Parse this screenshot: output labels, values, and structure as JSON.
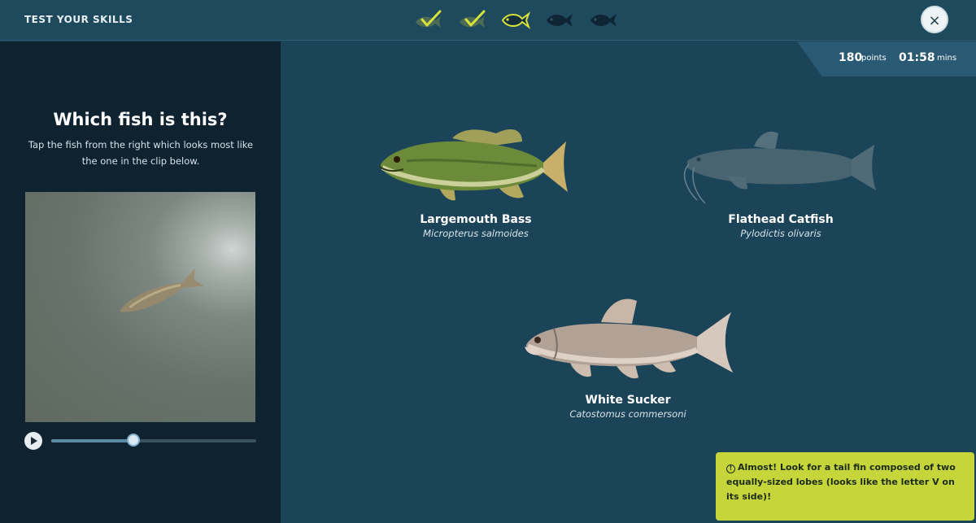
{
  "header": {
    "title": "TEST YOUR SKILLS",
    "progress": [
      {
        "state": "correct",
        "icon": "fish-check-icon"
      },
      {
        "state": "correct",
        "icon": "fish-check-icon"
      },
      {
        "state": "current",
        "icon": "fish-outline-icon"
      },
      {
        "state": "pending",
        "icon": "fish-icon"
      },
      {
        "state": "pending",
        "icon": "fish-icon"
      }
    ],
    "close_label": "×"
  },
  "score": {
    "points": "180",
    "points_unit": "points",
    "time": "01:58",
    "time_unit": "mins"
  },
  "question": {
    "title": "Which fish is this?",
    "instruction": "Tap the fish from the right which looks most like the one in the clip below."
  },
  "video": {
    "progress": 0.4
  },
  "options": [
    {
      "name": "Largemouth Bass",
      "scientific": "Micropterus salmoides",
      "state": "active"
    },
    {
      "name": "Flathead Catfish",
      "scientific": "Pylodictis olivaris",
      "state": "eliminated"
    },
    {
      "name": "White Sucker",
      "scientific": "Catostomus commersoni",
      "state": "active"
    }
  ],
  "hint": {
    "text": "Almost! Look for a tail fin composed of two equally-sized lobes (looks like the letter V on its side)!"
  },
  "colors": {
    "accent": "#c6d63a",
    "background": "#1c4459",
    "panel": "#0f2230"
  }
}
